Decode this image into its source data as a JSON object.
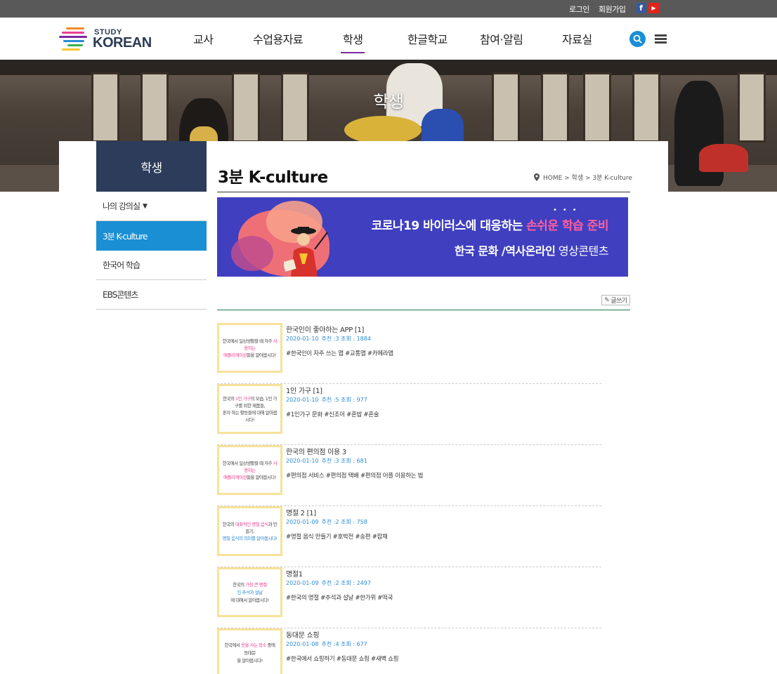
{
  "topbar": {
    "login": "로그인",
    "join": "회원가입",
    "facebook_icon": "facebook-icon",
    "youtube_icon": "youtube-icon"
  },
  "logo": {
    "line1": "STUDY",
    "line2": "KOREAN"
  },
  "nav": {
    "items": [
      "교사",
      "수업용자료",
      "학생",
      "한글학교",
      "참여·알림",
      "자료실"
    ],
    "active": "학생"
  },
  "hero": {
    "title": "학생"
  },
  "lnb": {
    "heading": "학생",
    "items": [
      {
        "label": "나의 강의실",
        "has_caret": true,
        "active": false
      },
      {
        "label": "3분 K-culture",
        "active": true
      },
      {
        "label": "한국어 학습",
        "active": false
      },
      {
        "label": "EBS콘텐츠",
        "active": false
      }
    ]
  },
  "page": {
    "title": "3분 K-culture",
    "breadcrumb": "HOME > 학생 > 3분 K-culture"
  },
  "banner": {
    "line1_a": "코로나19 바이러스에 대응하는 ",
    "line1_b": "손쉬운 학습 준비",
    "line2_a": "한국 문화 /역사온라인",
    "line2_b": " 영상콘텐츠"
  },
  "write_button": "글쓰기",
  "posts": [
    {
      "title": "한국인이 좋아하는 APP [1]",
      "date": "2020-01-10",
      "meta": "추천 :3  조회 : 1884",
      "tags": "#한국인이 자주 쓰는 앱 #교통앱 #카메라앱",
      "thumb_a": "한국에서 일상생활할 때 자주 ",
      "thumb_b": "사용하는",
      "thumb_c": "애플리케이션",
      "thumb_d": "들을 알아봅시다!"
    },
    {
      "title": "1인 가구 [1]",
      "date": "2020-01-10",
      "meta": "추천 :5  조회 : 977",
      "tags": "#1인가구 문화 #신조어 #혼밥 #혼술",
      "thumb_a": "한국의 ",
      "thumb_b": "1인 가구",
      "thumb_c": "의 모습, 1인 가구를 위한 제품들,",
      "thumb_d": "혼자 하는 활동들에 대해 알아봅시다!"
    },
    {
      "title": "한국의 편의점 이용 3",
      "date": "2020-01-10",
      "meta": "추천 :3  조회 : 681",
      "tags": "#편의점 서비스 #편의점 택배 #편의점 어플 이용하는 법",
      "thumb_a": "한국에서 일상생활할 때 자주 ",
      "thumb_b": "사용하는",
      "thumb_c": "애플리케이션",
      "thumb_d": "들을 알아봅시다!"
    },
    {
      "title": "명절 2 [1]",
      "date": "2020-01-09",
      "meta": "추천 :2  조회 : 758",
      "tags": "#명절 음식 만들기 #호박전 #송편 #잡채",
      "thumb_a": "한국의 ",
      "thumb_b": "대표적인 명절 음식",
      "thumb_c": "과 만들기,",
      "thumb_d": "명절 음식의 의미를 알아봅시다!"
    },
    {
      "title": "명절1",
      "date": "2020-01-09",
      "meta": "추천 :2  조회 : 2497",
      "tags": "#한국의 명절 #추석과 설날 #한가위 #떡국",
      "thumb_a": "한국의 ",
      "thumb_b": "가장 큰 명절",
      "thumb_c": "인 추석과 설날",
      "thumb_d": "에 대해서 알아봅시다!"
    },
    {
      "title": "동대문 쇼핑",
      "date": "2020-01-08",
      "meta": "추천 :4  조회 : 677",
      "tags": "#한국에서 쇼핑하기 #동대문 쇼핑 #새벽 쇼핑",
      "thumb_a": "한국에서 ",
      "thumb_b": "옷을 사는 장소",
      "thumb_c": " 중에 동대문",
      "thumb_d": "을 알아봅시다!"
    }
  ],
  "colors": {
    "lnb_head": "#2c3c5a",
    "lnb_active": "#1a8fd3",
    "nav_underline": "#7b2a9e",
    "banner_bg": "#3f3fc0",
    "meta_blue": "#2a8bd5"
  }
}
